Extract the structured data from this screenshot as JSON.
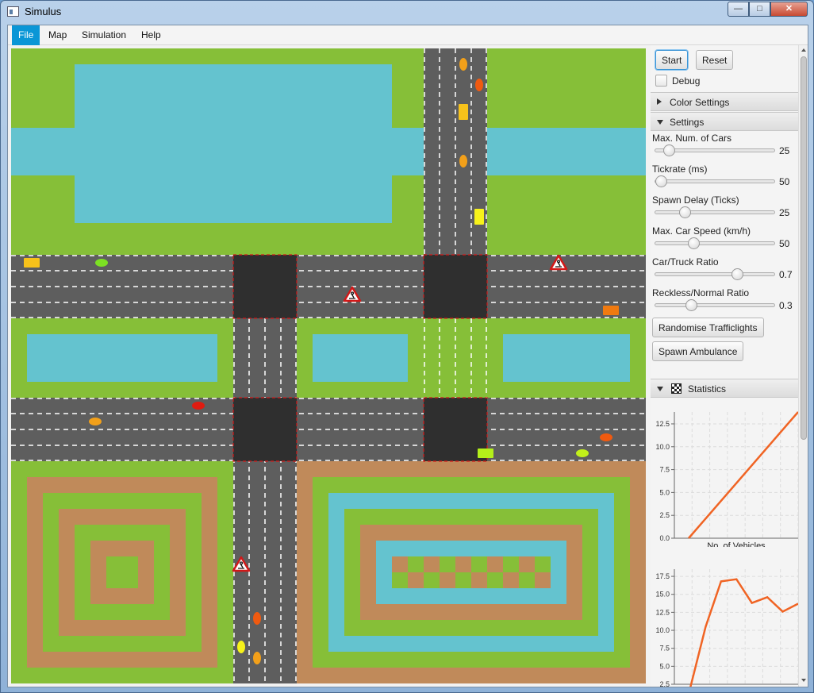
{
  "window": {
    "title": "Simulus",
    "min_glyph": "—",
    "max_glyph": "□",
    "close_glyph": "✕"
  },
  "menu": [
    "File",
    "Map",
    "Simulation",
    "Help"
  ],
  "controls": {
    "start_label": "Start",
    "reset_label": "Reset",
    "debug_label": "Debug",
    "debug_checked": false,
    "color_settings_title": "Color Settings",
    "settings_title": "Settings",
    "randomise_label": "Randomise Trafficlights",
    "ambulance_label": "Spawn Ambulance",
    "statistics_title": "Statistics"
  },
  "sliders": [
    {
      "label": "Max. Num. of Cars",
      "value": "25",
      "fraction": 0.07
    },
    {
      "label": "Tickrate (ms)",
      "value": "50",
      "fraction": 0.0
    },
    {
      "label": "Spawn Delay (Ticks)",
      "value": "25",
      "fraction": 0.22
    },
    {
      "label": "Max. Car Speed (km/h)",
      "value": "50",
      "fraction": 0.3
    },
    {
      "label": "Car/Truck Ratio",
      "value": "0.7",
      "fraction": 0.7
    },
    {
      "label": "Reckless/Normal Ratio",
      "value": "0.3",
      "fraction": 0.28
    }
  ],
  "colors": {
    "grass": "#86bf38",
    "water": "#64c3cf",
    "dirt": "#c08a5a",
    "road": "#5e5e5e",
    "junction": "#2f2f2f",
    "accent": "#0a96d6",
    "chart_line": "#f06424"
  },
  "chart_data": [
    {
      "type": "line",
      "xlabel": "No. of Vehicles",
      "ylabel": "",
      "yticks": [
        "0.0",
        "2.5",
        "5.0",
        "7.5",
        "10.0",
        "12.5"
      ],
      "ylim": [
        0,
        13.8
      ],
      "x": [
        0,
        1
      ],
      "values": [
        0,
        13.8
      ],
      "grid": true
    },
    {
      "type": "line",
      "xlabel": "",
      "ylabel": "",
      "yticks": [
        "2.5",
        "5.0",
        "7.5",
        "10.0",
        "12.5",
        "15.0",
        "17.5"
      ],
      "ylim": [
        2.5,
        18.5
      ],
      "x": [
        0,
        1,
        2,
        3,
        4,
        5,
        6,
        7
      ],
      "values": [
        2.0,
        10.5,
        16.8,
        17.1,
        13.8,
        14.6,
        12.6,
        13.7
      ],
      "grid": true
    }
  ]
}
